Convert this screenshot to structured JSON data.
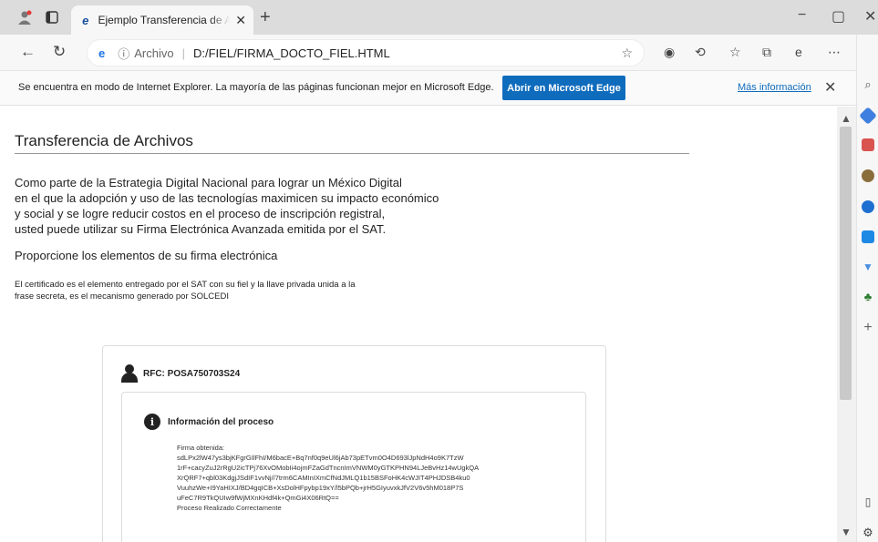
{
  "window": {
    "tab_title": "Ejemplo Transferencia de Archivos",
    "controls": {
      "minimize": "−",
      "restore": "▢",
      "close": "✕"
    }
  },
  "toolbar": {
    "security_label": "Archivo",
    "url": "D:/FIEL/FIRMA_DOCTO_FIEL.HTML"
  },
  "infobar": {
    "message": "Se encuentra en modo de Internet Explorer. La mayoría de las páginas funcionan mejor en Microsoft Edge.",
    "button": "Abrir en Microsoft Edge",
    "link": "Más información"
  },
  "page": {
    "title": "Transferencia de Archivos",
    "intro": [
      "Como parte de la Estrategia Digital Nacional para lograr un México Digital",
      "en el que la adopción y uso de las tecnologías maximicen su impacto económico",
      "y social y se logre reducir costos en el proceso de inscripción registral,",
      "usted puede utilizar su Firma Electrónica Avanzada emitida por el SAT."
    ],
    "subtitle": "Proporcione los elementos de su firma electrónica",
    "note": [
      "El certificado es el elemento entregado por el SAT con su fiel y la llave privada unida a la",
      "frase secreta, es el mecanismo generado por SOLCEDI"
    ],
    "rfc": "RFC: POSA750703S24",
    "info_heading": "Información del proceso",
    "process_lines": [
      "Firma obtenida:",
      "sdLPx2lW47ys3bjKFgrGIlFhI/M6bacE+Bq7nf0q9eUl6jAb73pETvm0O4D693lJpNdH4o9K7TzW",
      "1rF+cacyZuJ2rRgU2icTPj76XvOMobIi4ojmFZaGdTncnImVNWM0yGTKPHN94LJeBvHz14wUgkQA",
      "XrQRF7+qbl03KdgjJSdIF1vvNj//7trm6CAMInIXmCfNdJMLQ1b15BSFoHK4cWJIT4PHJDSB4ku0",
      "VuuhzWe+I9YaHIXJ/BD4gqICB+XsDolHFpybp19xY/l5bPQb+jrH5GIyuvxkJfV2V6v5hM018P7S",
      "uFeC7R9TkQUIw9fWjMXnKHdf4k+QmGi4X06RtQ==",
      "Proceso Realizado Correctamente"
    ]
  }
}
